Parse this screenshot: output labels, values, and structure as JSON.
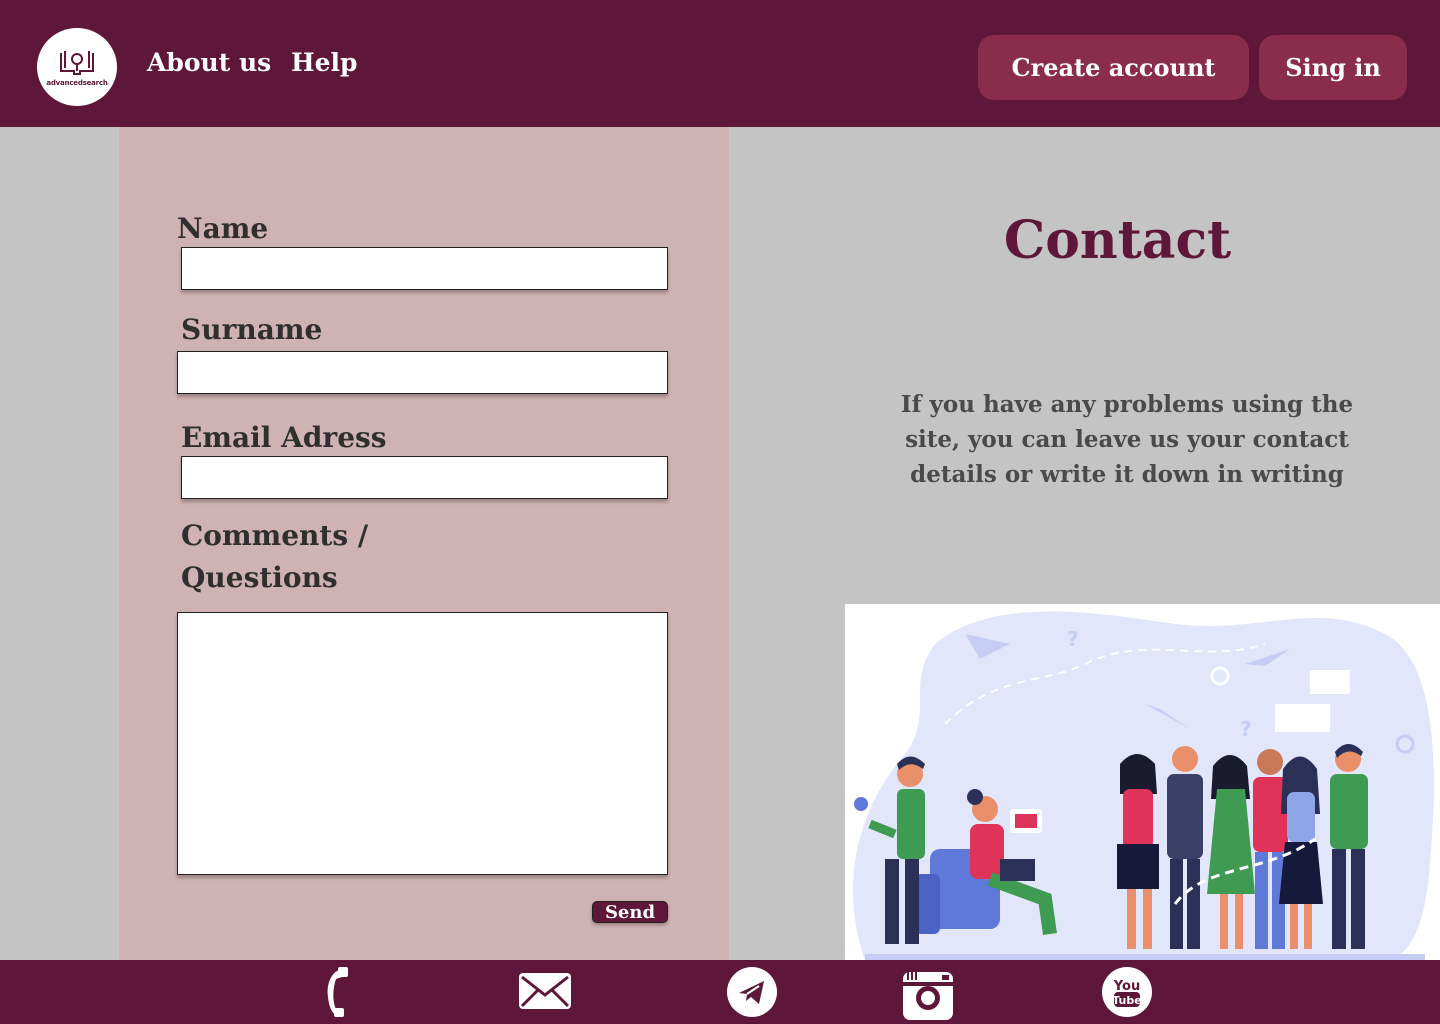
{
  "header": {
    "logo_text": "advancedsearch",
    "nav": [
      {
        "label": "About us"
      },
      {
        "label": "Help"
      }
    ],
    "create_account_label": "Create account",
    "sign_in_label": "Sing in"
  },
  "form": {
    "name_label": "Name",
    "surname_label": "Surname",
    "email_label": "Email Adress",
    "comments_label_line1": "Comments /",
    "comments_label_line2": "Questions",
    "name_value": "",
    "surname_value": "",
    "email_value": "",
    "comments_value": "",
    "send_label": "Send"
  },
  "contact": {
    "title": "Contact",
    "description": "If you have any problems using the site, you can leave us your contact details or write it down in writing"
  },
  "footer": {
    "icons": [
      "phone-icon",
      "mail-icon",
      "telegram-icon",
      "instagram-icon",
      "youtube-icon"
    ]
  },
  "colors": {
    "brand": "#5e1738",
    "button": "#8a2c4b",
    "form_bg": "#cfb2b3",
    "page_bg": "#c4c4c4"
  }
}
